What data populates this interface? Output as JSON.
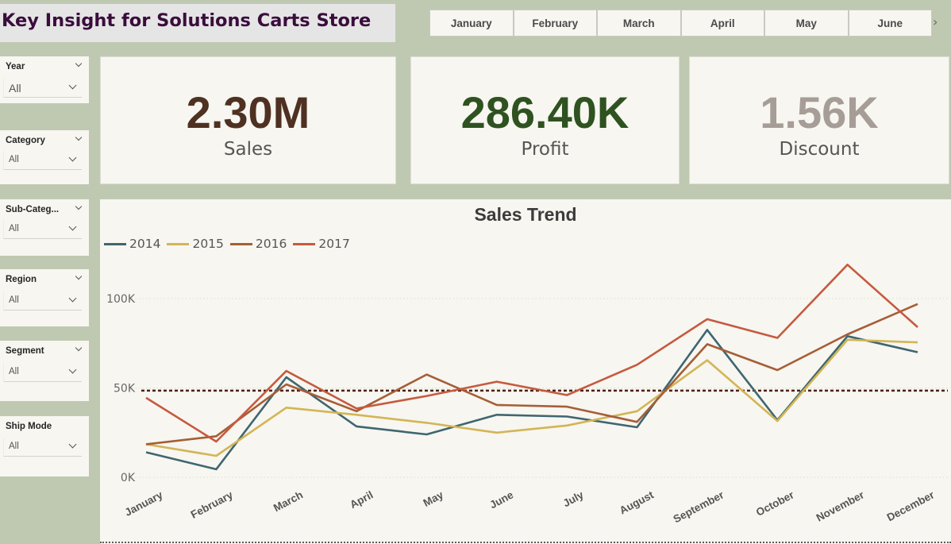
{
  "header": {
    "title": "Key Insight for Solutions Carts Store"
  },
  "months": [
    "January",
    "February",
    "March",
    "April",
    "May",
    "June"
  ],
  "next_icon": "chevron-right-icon",
  "slicers": [
    {
      "label": "Year",
      "value": "All"
    },
    {
      "label": "Category",
      "value": "All"
    },
    {
      "label": "Sub-Categ...",
      "value": "All"
    },
    {
      "label": "Region",
      "value": "All"
    },
    {
      "label": "Segment",
      "value": "All"
    },
    {
      "label": "Ship Mode",
      "value": "All"
    }
  ],
  "kpis": {
    "sales": {
      "value": "2.30M",
      "label": "Sales",
      "color": "#4f3121"
    },
    "profit": {
      "value": "286.40K",
      "label": "Profit",
      "color": "#2e5220"
    },
    "discount": {
      "value": "1.56K",
      "label": "Discount",
      "color": "#a69d97"
    }
  },
  "chart_data": {
    "type": "line",
    "title": "Sales Trend",
    "categories": [
      "January",
      "February",
      "March",
      "April",
      "May",
      "June",
      "July",
      "August",
      "September",
      "October",
      "November",
      "December"
    ],
    "yticks": [
      "0K",
      "50K",
      "100K"
    ],
    "ylim": [
      0,
      120000
    ],
    "reference_line": 48500,
    "series": [
      {
        "name": "2014",
        "color": "#3f6670",
        "values": [
          14000,
          4500,
          56000,
          28500,
          24000,
          35000,
          34000,
          28000,
          82500,
          32000,
          79000,
          70000
        ]
      },
      {
        "name": "2015",
        "color": "#d3b556",
        "values": [
          18500,
          12000,
          39000,
          35000,
          30500,
          25000,
          29000,
          37000,
          65500,
          31500,
          77000,
          75500
        ]
      },
      {
        "name": "2016",
        "color": "#a55e38",
        "values": [
          18500,
          23000,
          52000,
          37000,
          57500,
          40500,
          39500,
          31000,
          74500,
          60000,
          80000,
          97000
        ]
      },
      {
        "name": "2017",
        "color": "#c55a40",
        "values": [
          44500,
          20000,
          59500,
          38500,
          45500,
          53500,
          46000,
          63000,
          88500,
          78000,
          119000,
          84000
        ]
      }
    ],
    "legend_position": "top-left",
    "grid": true
  }
}
